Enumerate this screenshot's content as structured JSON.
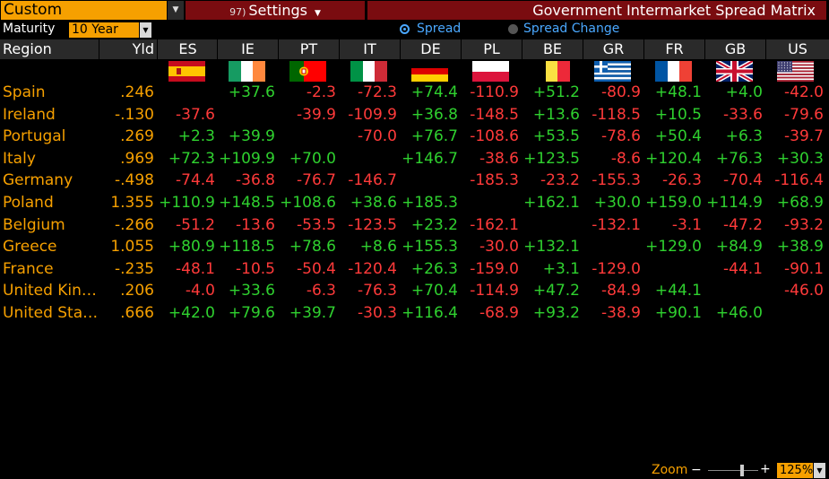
{
  "toolbar": {
    "custom_value": "Custom",
    "settings_number": "97)",
    "settings_label": "Settings",
    "title": "Government Intermarket Spread Matrix"
  },
  "controls": {
    "maturity_label": "Maturity",
    "maturity_value": "10 Year",
    "radio_spread": "Spread",
    "radio_spread_change": "Spread Change",
    "selected": "Spread"
  },
  "header": {
    "region": "Region",
    "yld": "Yld",
    "columns": [
      "ES",
      "IE",
      "PT",
      "IT",
      "DE",
      "PL",
      "BE",
      "GR",
      "FR",
      "GB",
      "US"
    ]
  },
  "rows": [
    {
      "name": "Spain",
      "yld": ".246",
      "values": [
        "",
        "+37.6",
        "-2.3",
        "-72.3",
        "+74.4",
        "-110.9",
        "+51.2",
        "-80.9",
        "+48.1",
        "+4.0",
        "-42.0"
      ]
    },
    {
      "name": "Ireland",
      "yld": "-.130",
      "values": [
        "-37.6",
        "",
        "-39.9",
        "-109.9",
        "+36.8",
        "-148.5",
        "+13.6",
        "-118.5",
        "+10.5",
        "-33.6",
        "-79.6"
      ]
    },
    {
      "name": "Portugal",
      "yld": ".269",
      "values": [
        "+2.3",
        "+39.9",
        "",
        "-70.0",
        "+76.7",
        "-108.6",
        "+53.5",
        "-78.6",
        "+50.4",
        "+6.3",
        "-39.7"
      ]
    },
    {
      "name": "Italy",
      "yld": ".969",
      "values": [
        "+72.3",
        "+109.9",
        "+70.0",
        "",
        "+146.7",
        "-38.6",
        "+123.5",
        "-8.6",
        "+120.4",
        "+76.3",
        "+30.3"
      ]
    },
    {
      "name": "Germany",
      "yld": "-.498",
      "values": [
        "-74.4",
        "-36.8",
        "-76.7",
        "-146.7",
        "",
        "-185.3",
        "-23.2",
        "-155.3",
        "-26.3",
        "-70.4",
        "-116.4"
      ]
    },
    {
      "name": "Poland",
      "yld": "1.355",
      "values": [
        "+110.9",
        "+148.5",
        "+108.6",
        "+38.6",
        "+185.3",
        "",
        "+162.1",
        "+30.0",
        "+159.0",
        "+114.9",
        "+68.9"
      ]
    },
    {
      "name": "Belgium",
      "yld": "-.266",
      "values": [
        "-51.2",
        "-13.6",
        "-53.5",
        "-123.5",
        "+23.2",
        "-162.1",
        "",
        "-132.1",
        "-3.1",
        "-47.2",
        "-93.2"
      ]
    },
    {
      "name": "Greece",
      "yld": "1.055",
      "values": [
        "+80.9",
        "+118.5",
        "+78.6",
        "+8.6",
        "+155.3",
        "-30.0",
        "+132.1",
        "",
        "+129.0",
        "+84.9",
        "+38.9"
      ]
    },
    {
      "name": "France",
      "yld": "-.235",
      "values": [
        "-48.1",
        "-10.5",
        "-50.4",
        "-120.4",
        "+26.3",
        "-159.0",
        "+3.1",
        "-129.0",
        "",
        "-44.1",
        "-90.1"
      ]
    },
    {
      "name": "United Kin…",
      "yld": ".206",
      "values": [
        "-4.0",
        "+33.6",
        "-6.3",
        "-76.3",
        "+70.4",
        "-114.9",
        "+47.2",
        "-84.9",
        "+44.1",
        "",
        "-46.0"
      ]
    },
    {
      "name": "United Sta…",
      "yld": ".666",
      "values": [
        "+42.0",
        "+79.6",
        "+39.7",
        "-30.3",
        "+116.4",
        "-68.9",
        "+93.2",
        "-38.9",
        "+90.1",
        "+46.0",
        ""
      ]
    }
  ],
  "zoom": {
    "label": "Zoom",
    "minus": "−",
    "plus": "+",
    "value": "125%"
  },
  "colors": {
    "accent_orange": "#f6a000",
    "title_bar_red": "#7a0c10",
    "positive": "#2fd12f",
    "negative": "#ff3a3a",
    "radio_blue": "#4aa8ff"
  },
  "flags": [
    "spain-flag-icon",
    "ireland-flag-icon",
    "portugal-flag-icon",
    "italy-flag-icon",
    "germany-flag-icon",
    "poland-flag-icon",
    "belgium-flag-icon",
    "greece-flag-icon",
    "france-flag-icon",
    "uk-flag-icon",
    "usa-flag-icon"
  ]
}
